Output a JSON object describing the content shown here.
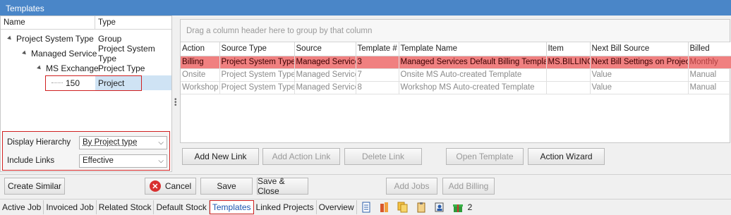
{
  "window": {
    "title": "Templates"
  },
  "tree": {
    "headers": {
      "name": "Name",
      "type": "Type"
    },
    "rows": [
      {
        "name": "Project System Type",
        "type": "Group"
      },
      {
        "name": "Managed Service",
        "type": "Project System Type"
      },
      {
        "name": "MS Exchange",
        "type": "Project Type"
      },
      {
        "name": "150",
        "type": "Project"
      }
    ]
  },
  "options": {
    "display_hierarchy_label": "Display Hierarchy",
    "display_hierarchy_value": "By Project type",
    "include_links_label": "Include Links",
    "include_links_value": "Effective"
  },
  "grid": {
    "group_hint": "Drag a column header here to group by that column",
    "columns": [
      "Action",
      "Source Type",
      "Source",
      "Template #",
      "Template Name",
      "Item",
      "Next Bill Source",
      "Billed"
    ],
    "rows": [
      [
        "Billing",
        "Project System Type",
        "Managed Service",
        "3",
        "Managed Services Default Billing Template",
        "MS.BILLING",
        "Next Bill Settings on Project",
        "Monthly"
      ],
      [
        "Onsite",
        "Project System Type",
        "Managed Service",
        "7",
        "Onsite MS Auto-created Template",
        "",
        "Value",
        "Manual"
      ],
      [
        "Workshop",
        "Project System Type",
        "Managed Service",
        "8",
        "Workshop MS Auto-created Template",
        "",
        "Value",
        "Manual"
      ]
    ]
  },
  "link_buttons": {
    "add_new_link": "Add New Link",
    "add_action_link": "Add Action Link",
    "delete_link": "Delete Link",
    "open_template": "Open Template",
    "action_wizard": "Action Wizard"
  },
  "bottom_buttons": {
    "create_similar": "Create Similar",
    "cancel": "Cancel",
    "save": "Save",
    "save_close": "Save & Close",
    "add_jobs": "Add Jobs",
    "add_billing": "Add Billing"
  },
  "tabs": [
    "Active Job",
    "Invoiced Job",
    "Related Stock",
    "Default Stock",
    "Templates",
    "Linked Projects",
    "Overview"
  ],
  "tab_icons": [
    "invoice-icon",
    "books-icon",
    "documents-icon",
    "clipboard-icon",
    "contacts-icon",
    "gift-icon"
  ],
  "tab_count": "2",
  "colors": {
    "titlebar": "#4a86c8",
    "highlight_row": "#f08080",
    "selection": "#cfe3f4",
    "callout": "#d02020"
  }
}
